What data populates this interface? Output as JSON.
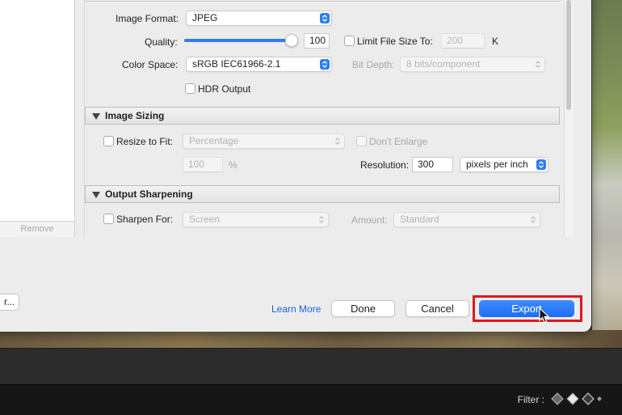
{
  "export_dialog": {
    "left_panel": {
      "remove_label": "Remove",
      "cut_button_label": "r..."
    },
    "file_settings": {
      "image_format_label": "Image Format:",
      "image_format_value": "JPEG",
      "quality_label": "Quality:",
      "quality_value": "100",
      "quality_slider_fraction": 1.0,
      "limit_file_size_label": "Limit File Size To:",
      "limit_file_size_value": "200",
      "limit_file_size_unit": "K",
      "color_space_label": "Color Space:",
      "color_space_value": "sRGB IEC61966-2.1",
      "bit_depth_label": "Bit Depth:",
      "bit_depth_value": "8 bits/component",
      "hdr_output_label": "HDR Output"
    },
    "image_sizing": {
      "title": "Image Sizing",
      "resize_to_fit_label": "Resize to Fit:",
      "resize_mode_value": "Percentage",
      "dont_enlarge_label": "Don't Enlarge",
      "percentage_value": "100",
      "percentage_unit": "%",
      "resolution_label": "Resolution:",
      "resolution_value": "300",
      "resolution_unit_value": "pixels per inch"
    },
    "output_sharpening": {
      "title": "Output Sharpening",
      "sharpen_for_label": "Sharpen For:",
      "sharpen_for_value": "Screen",
      "amount_label": "Amount:",
      "amount_value": "Standard"
    },
    "footer": {
      "learn_more": "Learn More",
      "done": "Done",
      "cancel": "Cancel",
      "export": "Export"
    }
  },
  "app_bar": {
    "filter_label": "Filter :"
  },
  "colors": {
    "accent": "#2f7cf6",
    "highlight_box": "#e0161e"
  }
}
